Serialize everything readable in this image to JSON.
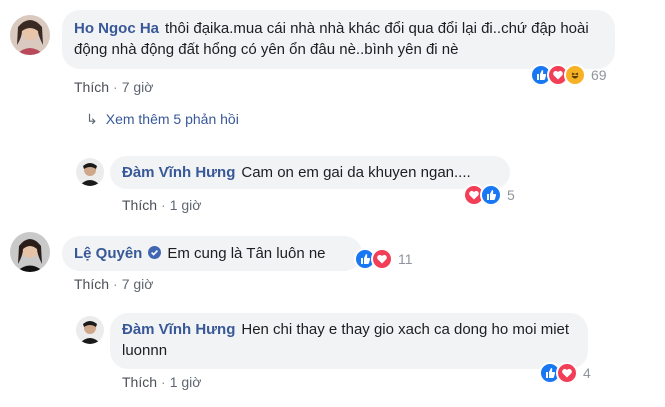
{
  "comments": [
    {
      "author": "Ho Ngoc Ha",
      "text": "thôi đạika.mua cái nhà nhà khác đổi qua đổi lại đi..chứ đập hoài động nhà động đất hổng có yên ổn đâu nè..bình yên đi nè",
      "like_label": "Thích",
      "time": "7 giờ",
      "reaction_count": "69",
      "reactions": [
        "like-icon",
        "love-icon",
        "haha-icon"
      ],
      "view_more": "Xem thêm 5 phản hồi"
    },
    {
      "author": "Đàm Vĩnh Hưng",
      "text": "Cam on em gai da khuyen ngan....",
      "like_label": "Thích",
      "time": "1 giờ",
      "reaction_count": "5",
      "reactions": [
        "love-icon",
        "like-icon"
      ]
    },
    {
      "author": "Lệ Quyên",
      "text": "Em cung là Tân luôn ne",
      "like_label": "Thích",
      "time": "7 giờ",
      "reaction_count": "11",
      "reactions": [
        "like-icon",
        "love-icon"
      ]
    },
    {
      "author": "Đàm Vĩnh Hưng",
      "text": "Hen chi thay e thay gio xach ca dong ho moi miet luonnn",
      "like_label": "Thích",
      "time": "1 giờ",
      "reaction_count": "4",
      "reactions": [
        "like-icon",
        "love-icon"
      ]
    }
  ],
  "colors": {
    "name": "#385898",
    "like": "#1877f2",
    "love": "#f33e58",
    "haha": "#f7b125",
    "bubble": "#f2f3f5"
  }
}
